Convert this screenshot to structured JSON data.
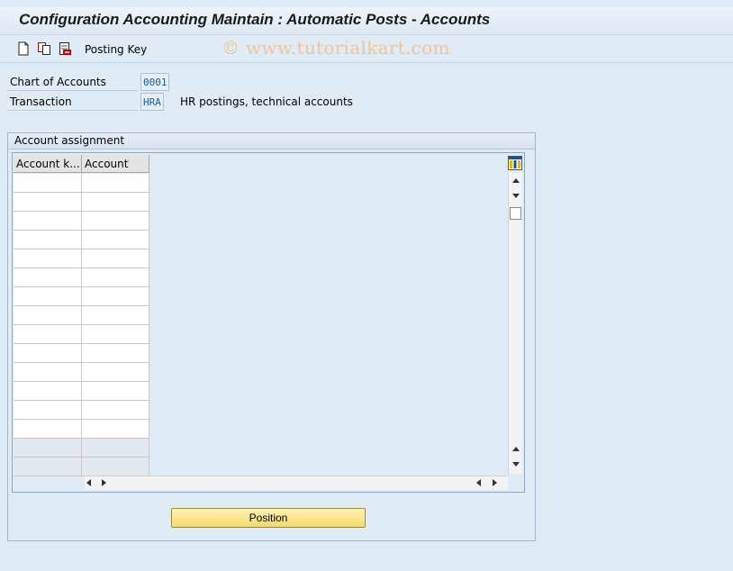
{
  "window": {
    "title": "Configuration Accounting Maintain : Automatic Posts - Accounts"
  },
  "toolbar": {
    "icons": [
      "new-entry-icon",
      "copy-icon",
      "delete-icon"
    ],
    "posting_key_label": "Posting Key"
  },
  "watermark": "© www.tutorialkart.com",
  "fields": {
    "chart_of_accounts": {
      "label": "Chart of Accounts",
      "value": "0001"
    },
    "transaction": {
      "label": "Transaction",
      "value": "HRA",
      "description": "HR postings, technical accounts"
    }
  },
  "account_assignment": {
    "title": "Account assignment",
    "columns": [
      "Account k...",
      "Account"
    ],
    "rows": [
      [
        "",
        ""
      ],
      [
        "",
        ""
      ],
      [
        "",
        ""
      ],
      [
        "",
        ""
      ],
      [
        "",
        ""
      ],
      [
        "",
        ""
      ],
      [
        "",
        ""
      ],
      [
        "",
        ""
      ],
      [
        "",
        ""
      ],
      [
        "",
        ""
      ],
      [
        "",
        ""
      ],
      [
        "",
        ""
      ],
      [
        "",
        ""
      ],
      [
        "",
        ""
      ],
      [
        "",
        ""
      ],
      [
        "",
        ""
      ]
    ],
    "editable_row_count": 14,
    "table_settings_icon": "table-settings-icon"
  },
  "buttons": {
    "position": "Position"
  },
  "colors": {
    "background": "#dfebf5",
    "button_yellow": "#f7d96a",
    "watermark": "#f0c49a",
    "field_value_text": "#1d5a9a"
  }
}
